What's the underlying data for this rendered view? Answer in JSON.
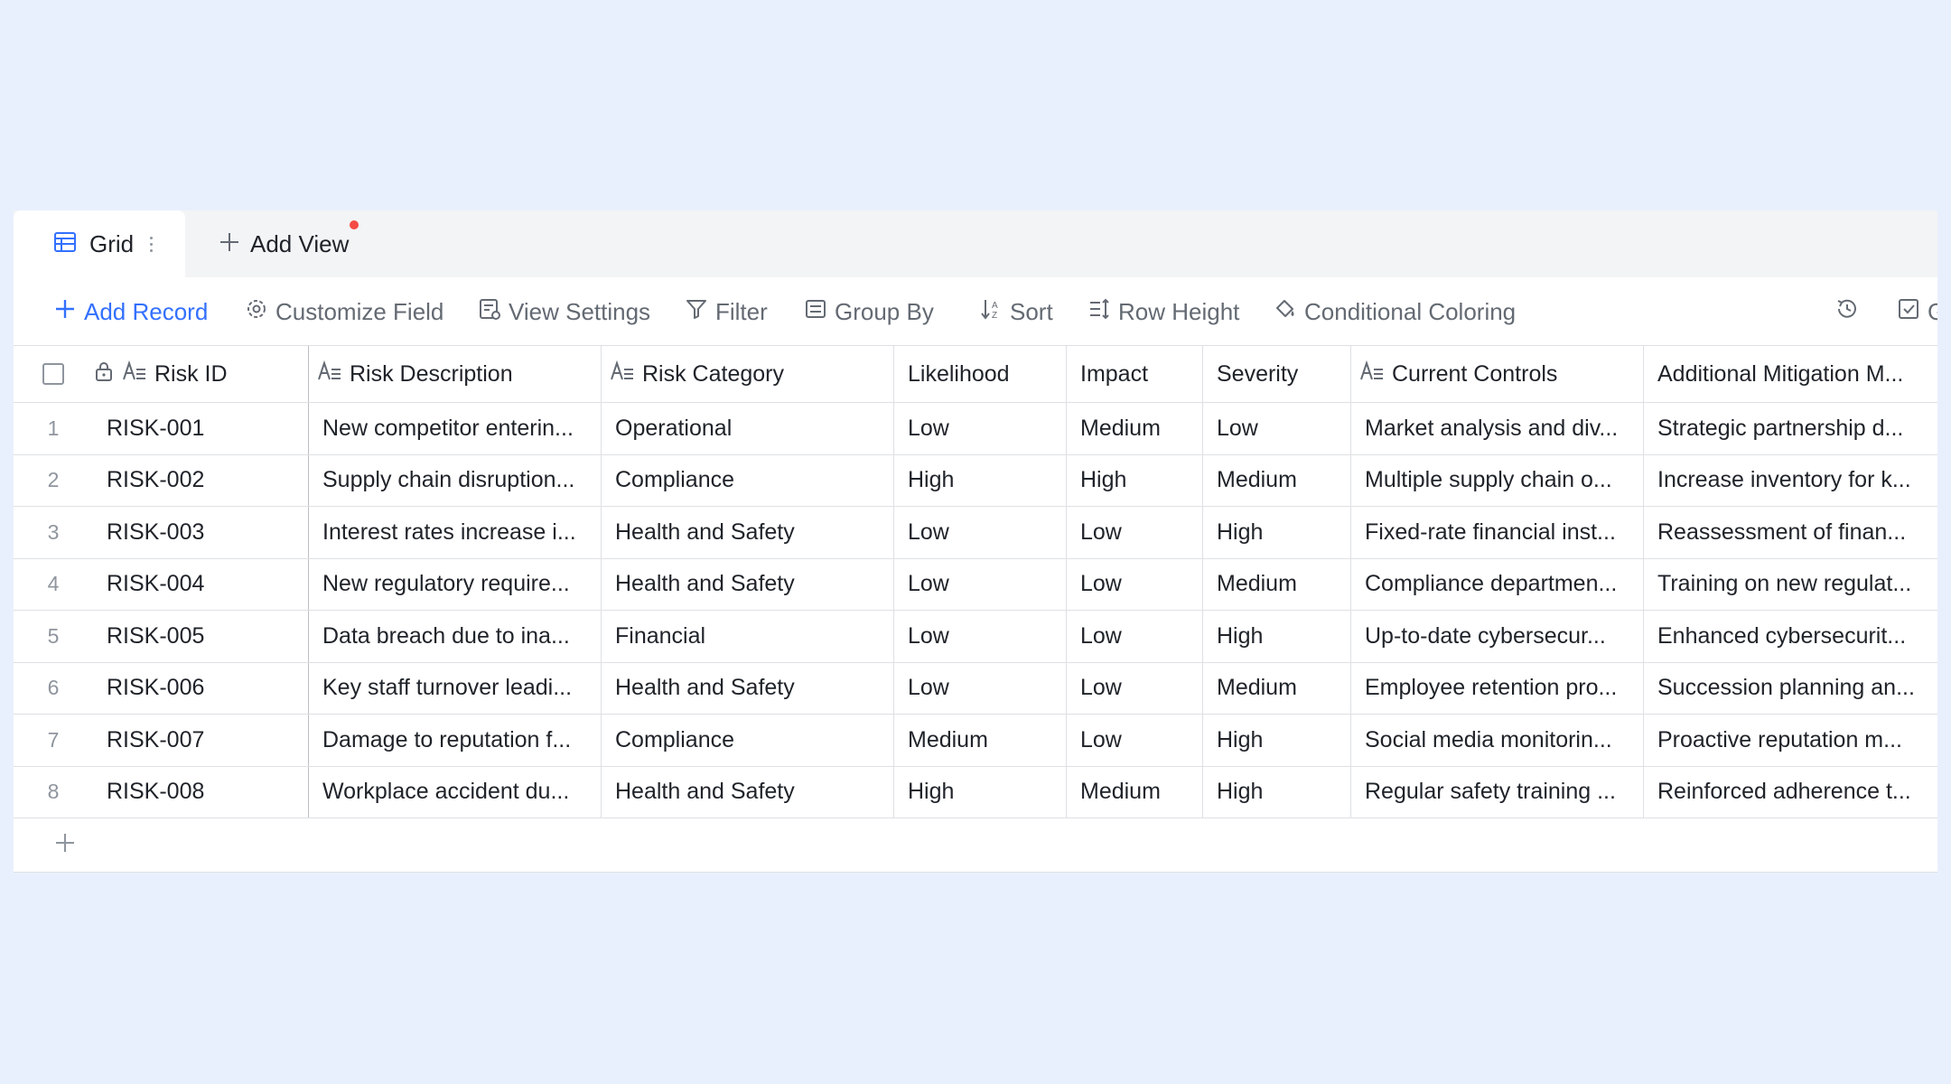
{
  "tabs": {
    "grid_label": "Grid",
    "add_view_label": "Add View"
  },
  "toolbar": {
    "add_record": "Add Record",
    "customize_field": "Customize Field",
    "view_settings": "View Settings",
    "filter": "Filter",
    "group_by": "Group By",
    "sort": "Sort",
    "row_height": "Row Height",
    "conditional_coloring": "Conditional Coloring",
    "truncated_item": "Ge"
  },
  "columns": [
    {
      "label": "Risk ID"
    },
    {
      "label": "Risk Description"
    },
    {
      "label": "Risk Category"
    },
    {
      "label": "Likelihood"
    },
    {
      "label": "Impact"
    },
    {
      "label": "Severity"
    },
    {
      "label": "Current Controls"
    },
    {
      "label": "Additional Mitigation M..."
    }
  ],
  "rows": [
    {
      "num": "1",
      "cells": [
        "RISK-001",
        "New competitor enterin...",
        "Operational",
        "Low",
        "Medium",
        "Low",
        "Market analysis and div...",
        "Strategic partnership d..."
      ]
    },
    {
      "num": "2",
      "cells": [
        "RISK-002",
        "Supply chain disruption...",
        "Compliance",
        "High",
        "High",
        "Medium",
        "Multiple supply chain o...",
        "Increase inventory for k..."
      ]
    },
    {
      "num": "3",
      "cells": [
        "RISK-003",
        "Interest rates increase i...",
        "Health and Safety",
        "Low",
        "Low",
        "High",
        "Fixed-rate financial inst...",
        "Reassessment of finan..."
      ]
    },
    {
      "num": "4",
      "cells": [
        "RISK-004",
        "New regulatory require...",
        "Health and Safety",
        "Low",
        "Low",
        "Medium",
        "Compliance departmen...",
        "Training on new regulat..."
      ]
    },
    {
      "num": "5",
      "cells": [
        "RISK-005",
        "Data breach due to ina...",
        "Financial",
        "Low",
        "Low",
        "High",
        "Up-to-date cybersecur...",
        "Enhanced cybersecurit..."
      ]
    },
    {
      "num": "6",
      "cells": [
        "RISK-006",
        "Key staff turnover leadi...",
        "Health and Safety",
        "Low",
        "Low",
        "Medium",
        "Employee retention pro...",
        "Succession planning an..."
      ]
    },
    {
      "num": "7",
      "cells": [
        "RISK-007",
        "Damage to reputation f...",
        "Compliance",
        "Medium",
        "Low",
        "High",
        "Social media monitorin...",
        "Proactive reputation m..."
      ]
    },
    {
      "num": "8",
      "cells": [
        "RISK-008",
        "Workplace accident du...",
        "Health and Safety",
        "High",
        "Medium",
        "High",
        "Regular safety training ...",
        "Reinforced adherence t..."
      ]
    }
  ],
  "colors": {
    "accent": "#3370ff",
    "notification_dot": "#f54a45",
    "background": "#e9f0fd"
  }
}
